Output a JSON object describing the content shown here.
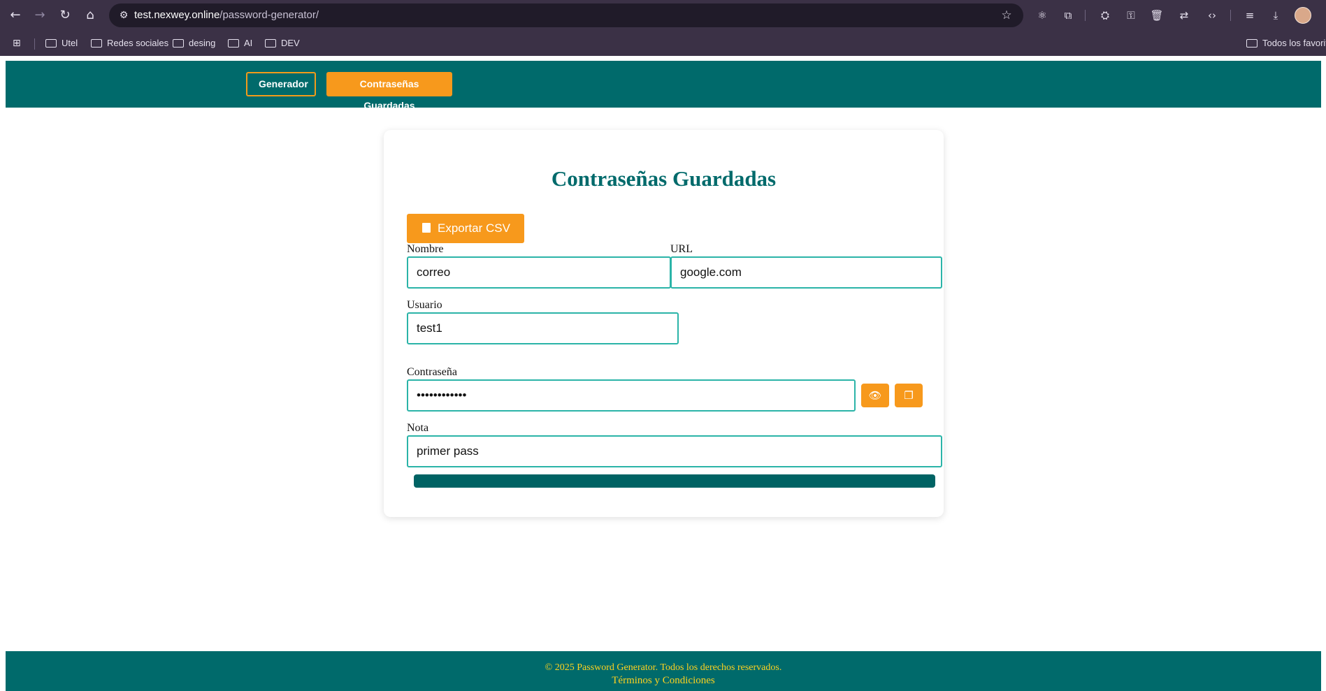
{
  "browser": {
    "url_host": "test.nexwey.online",
    "url_path": "/password-generator/",
    "bookmarks": [
      "Utel",
      "Redes sociales",
      "desing",
      "AI",
      "DEV"
    ],
    "bookmarks_right": "Todos los favoritos"
  },
  "nav": {
    "generator_label": "Generador",
    "saved_label": "Contraseñas Guardadas"
  },
  "card": {
    "title": "Contraseñas Guardadas",
    "export_label": "Exportar CSV",
    "fields": {
      "nombre_label": "Nombre",
      "nombre_value": "correo",
      "url_label": "URL",
      "url_value": "google.com",
      "usuario_label": "Usuario",
      "usuario_value": "test1",
      "password_label": "Contraseña",
      "password_value": "••••••••••••",
      "nota_label": "Nota",
      "nota_value": "primer pass"
    }
  },
  "footer": {
    "copyright": "© 2025 Password Generator. Todos los derechos reservados.",
    "terms": "Términos y Condiciones"
  },
  "colors": {
    "brand_teal": "#006a6b",
    "accent_orange": "#f7991c",
    "field_border": "#2bb4a8",
    "footer_text": "#ffd21f"
  }
}
